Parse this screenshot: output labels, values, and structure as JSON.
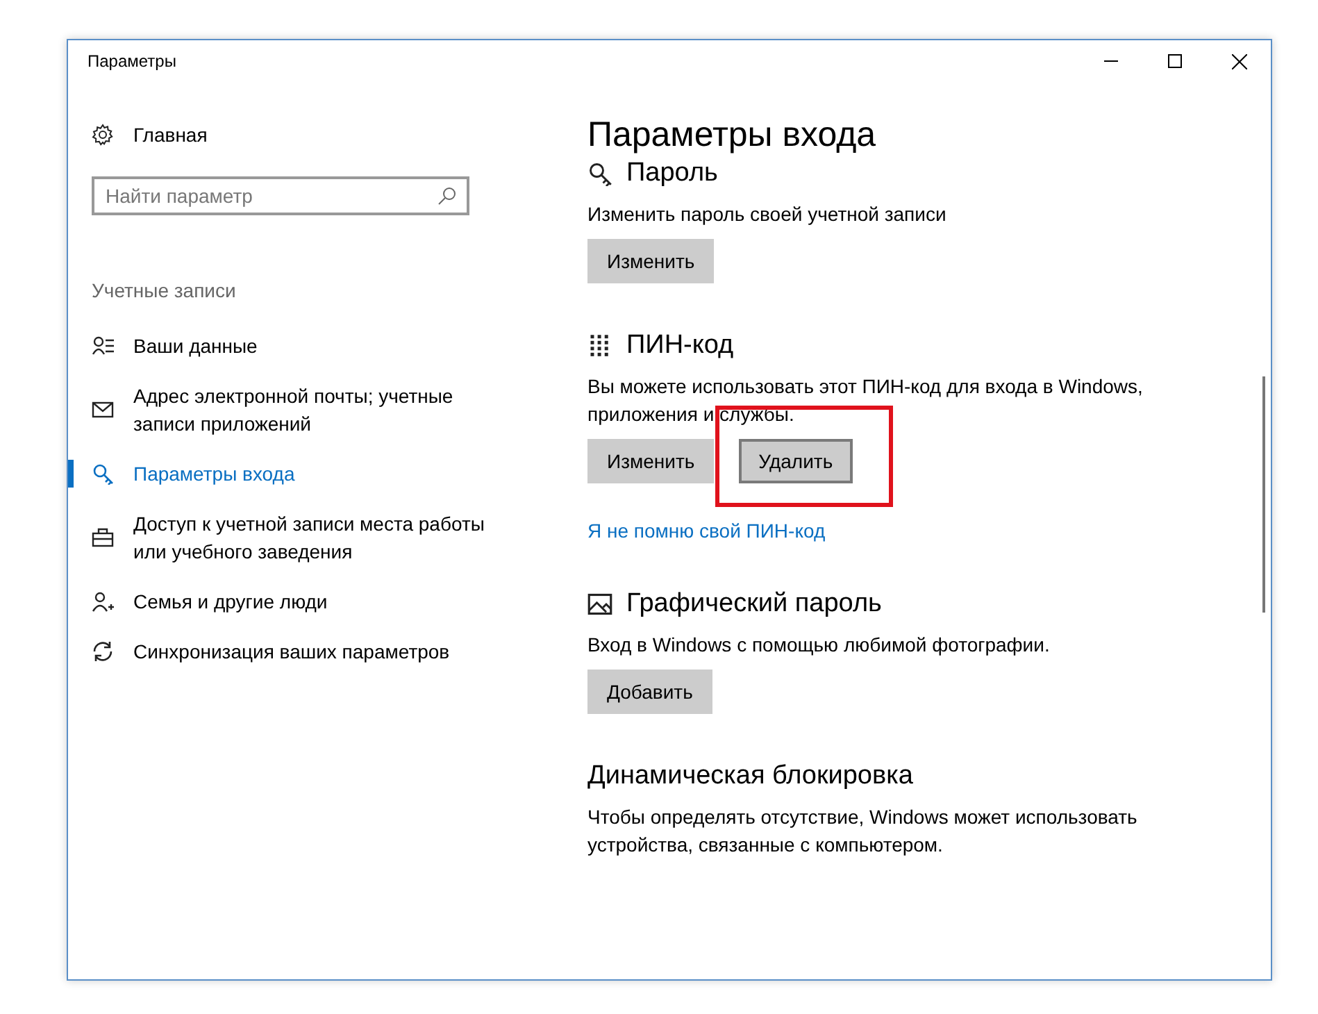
{
  "window": {
    "title": "Параметры"
  },
  "sidebar": {
    "home": "Главная",
    "search": {
      "placeholder": "Найти параметр"
    },
    "group": "Учетные записи",
    "items": [
      {
        "label": "Ваши данные",
        "selected": false
      },
      {
        "label": "Адрес электронной почты; учетные записи приложений",
        "selected": false
      },
      {
        "label": "Параметры входа",
        "selected": true
      },
      {
        "label": "Доступ к учетной записи места работы или учебного заведения",
        "selected": false
      },
      {
        "label": "Семья и другие люди",
        "selected": false
      },
      {
        "label": "Синхронизация ваших параметров",
        "selected": false
      }
    ]
  },
  "page": {
    "title": "Параметры входа",
    "sections": [
      {
        "heading": "Пароль",
        "description": "Изменить пароль своей учетной записи",
        "buttons": [
          {
            "label": "Изменить",
            "focused": false,
            "highlighted": false
          }
        ]
      },
      {
        "heading": "ПИН-код",
        "description": "Вы можете использовать этот ПИН-код для входа в Windows, приложения и службы.",
        "buttons": [
          {
            "label": "Изменить",
            "focused": false,
            "highlighted": false
          },
          {
            "label": "Удалить",
            "focused": true,
            "highlighted": true
          }
        ],
        "link": "Я не помню свой ПИН-код"
      },
      {
        "heading": "Графический пароль",
        "description": "Вход в Windows с помощью любимой фотографии.",
        "buttons": [
          {
            "label": "Добавить",
            "focused": false,
            "highlighted": false
          }
        ]
      },
      {
        "heading": "Динамическая блокировка",
        "description": "Чтобы определять отсутствие, Windows может использовать устройства, связанные с компьютером."
      }
    ]
  }
}
